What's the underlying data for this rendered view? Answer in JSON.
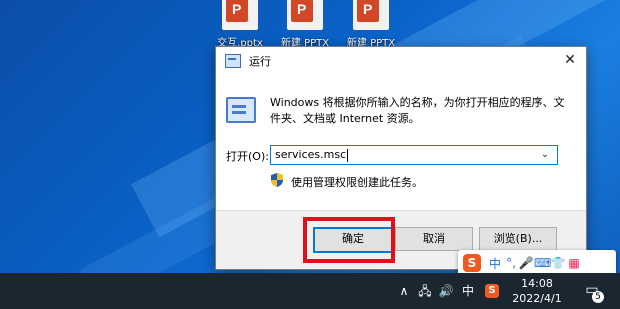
{
  "desktop": {
    "icons": [
      {
        "label": "交互.pptx",
        "icon": "pptx-file-icon"
      },
      {
        "label": "新建 PPTX",
        "icon": "pptx-file-icon"
      },
      {
        "label": "新建 PPTX",
        "icon": "pptx-file-icon"
      }
    ]
  },
  "dialog": {
    "title": "运行",
    "close_glyph": "✕",
    "description": "Windows 将根据你所输入的名称，为你打开相应的程序、文件夹、文档或 Internet 资源。",
    "open_label": "打开(O):",
    "open_value": "services.msc",
    "dropdown_glyph": "⌄",
    "admin_text": "使用管理权限创建此任务。",
    "buttons": {
      "ok": "确定",
      "cancel": "取消",
      "browse": "浏览(B)..."
    }
  },
  "ime_toolbar": {
    "logo": "S",
    "mode": "中",
    "punct": "°,",
    "mic": "🎤",
    "keyboard": "⌨",
    "skin": "👕",
    "tools": "▦"
  },
  "taskbar": {
    "tray": {
      "chevron": "∧",
      "network": "🖧",
      "volume": "🔊",
      "ime_mode": "中",
      "sogou": "S"
    },
    "time": "14:08",
    "date": "2022/4/1",
    "notifications_count": "5",
    "notification_glyph": "▭"
  },
  "colors": {
    "highlight": "#e0101a",
    "accent": "#0078d7",
    "taskbar": "#1c2631"
  }
}
